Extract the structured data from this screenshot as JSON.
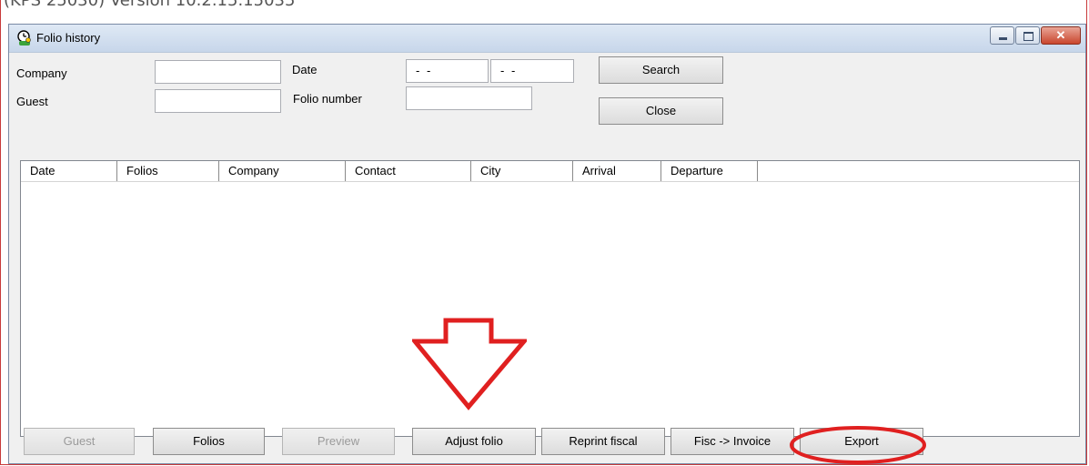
{
  "caption_text": "(KPS 25030) Version 10.2.15.15035",
  "window": {
    "title": "Folio history",
    "icon": "clock-person-icon",
    "controls": [
      "minimize-icon",
      "maximize-icon",
      "close-icon"
    ]
  },
  "filters": {
    "company_label": "Company",
    "company_value": "",
    "guest_label": "Guest",
    "guest_value": "",
    "date_label": "Date",
    "date_from": "- -",
    "date_to": "- -",
    "folio_number_label": "Folio number",
    "folio_number_value": ""
  },
  "buttons": {
    "search": "Search",
    "close": "Close"
  },
  "grid": {
    "columns": [
      "Date",
      "Folios",
      "Company",
      "Contact",
      "City",
      "Arrival",
      "Departure"
    ],
    "rows": []
  },
  "bottom_buttons": {
    "guest": "Guest",
    "folios": "Folios",
    "preview": "Preview",
    "adjust_folio": "Adjust folio",
    "reprint_fiscal": "Reprint fiscal",
    "fisc_invoice": "Fisc -> Invoice",
    "export": "Export"
  },
  "annotations": {
    "color": "#e02020",
    "arrow": "down-arrow",
    "highlight": "ellipse around Export"
  }
}
